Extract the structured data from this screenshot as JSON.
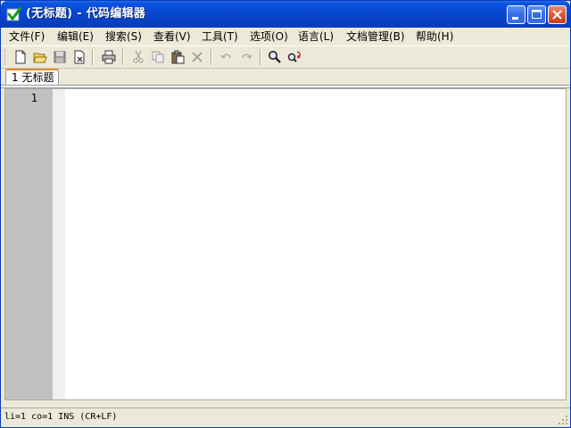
{
  "window": {
    "title": "(无标题) - 代码编辑器"
  },
  "menu": [
    {
      "label": "文件(F)"
    },
    {
      "label": "编辑(E)"
    },
    {
      "label": "搜索(S)"
    },
    {
      "label": "查看(V)"
    },
    {
      "label": "工具(T)"
    },
    {
      "label": "选项(O)"
    },
    {
      "label": "语言(L)"
    },
    {
      "label": "文档管理(B)"
    },
    {
      "label": "帮助(H)"
    }
  ],
  "toolbar": [
    {
      "icon": "new-file-icon"
    },
    {
      "icon": "open-folder-icon"
    },
    {
      "icon": "save-icon"
    },
    {
      "icon": "close-file-icon"
    },
    {
      "icon": "print-icon"
    },
    {
      "icon": "cut-icon"
    },
    {
      "icon": "copy-icon"
    },
    {
      "icon": "paste-icon"
    },
    {
      "icon": "delete-icon"
    },
    {
      "icon": "undo-icon"
    },
    {
      "icon": "redo-icon"
    },
    {
      "icon": "find-icon"
    },
    {
      "icon": "replace-icon"
    }
  ],
  "tabs": [
    {
      "label": "1 无标题",
      "active": true
    }
  ],
  "editor": {
    "line_numbers": [
      "1"
    ]
  },
  "status": {
    "text": "li=1 co=1 INS (CR+LF)"
  },
  "colors": {
    "title_bar": "#0848d2",
    "chrome": "#ece9d8",
    "gutter": "#c0c0c0",
    "active_tab_accent": "#e68b2c"
  }
}
